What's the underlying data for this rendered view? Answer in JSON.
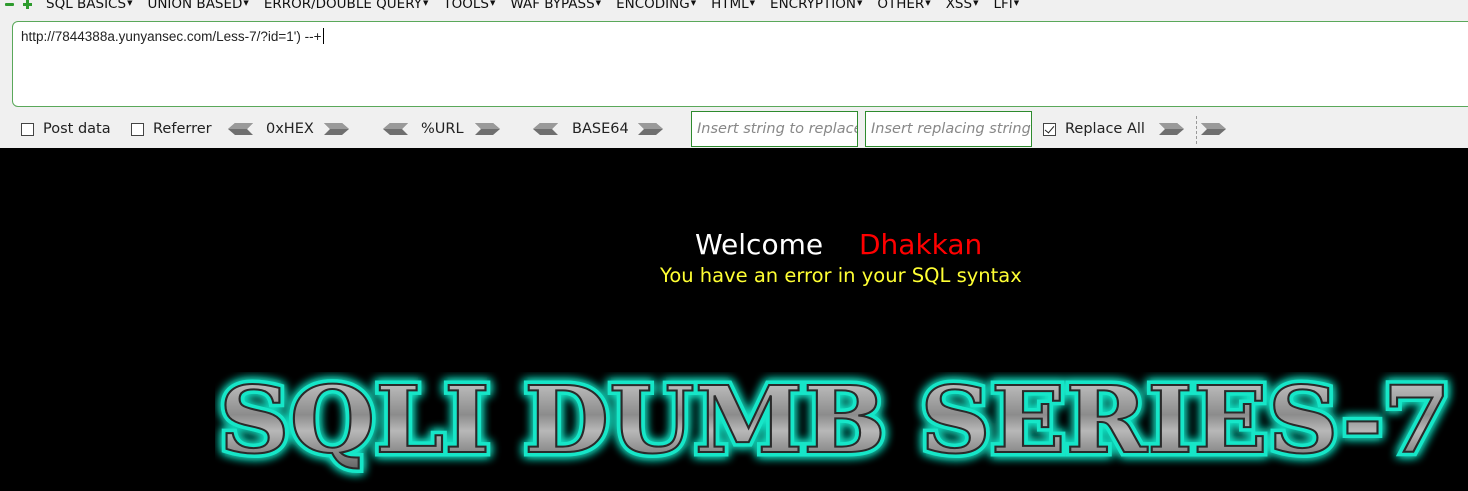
{
  "menubar": {
    "items": [
      {
        "label": "SQL BASICS"
      },
      {
        "label": "UNION BASED"
      },
      {
        "label": "ERROR/DOUBLE QUERY"
      },
      {
        "label": "TOOLS"
      },
      {
        "label": "WAF BYPASS"
      },
      {
        "label": "ENCODING"
      },
      {
        "label": "HTML"
      },
      {
        "label": "ENCRYPTION"
      },
      {
        "label": "OTHER"
      },
      {
        "label": "XSS"
      },
      {
        "label": "LFI"
      }
    ]
  },
  "url_field": {
    "value": "http://7844388a.yunyansec.com/Less-7/?id=1') --+"
  },
  "options": {
    "post_data": {
      "label": "Post data",
      "checked": false
    },
    "referrer": {
      "label": "Referrer",
      "checked": false
    },
    "hex_label": "0xHEX",
    "url_label": "%URL",
    "base64_label": "BASE64",
    "insert_string_placeholder": "Insert string to replace",
    "insert_replacing_placeholder": "Insert replacing string",
    "replace_all": {
      "label": "Replace All",
      "checked": true
    }
  },
  "content": {
    "welcome_word": "Welcome",
    "welcome_name": "Dhakkan",
    "error_message": "You have an error in your SQL syntax",
    "banner_text": "SQLI DUMB SERIES-7"
  },
  "colors": {
    "accent_green": "#2e8b2e",
    "welcome_name": "#ff0000",
    "error_message": "#ffff33",
    "banner_glow": "#19e6c8"
  }
}
